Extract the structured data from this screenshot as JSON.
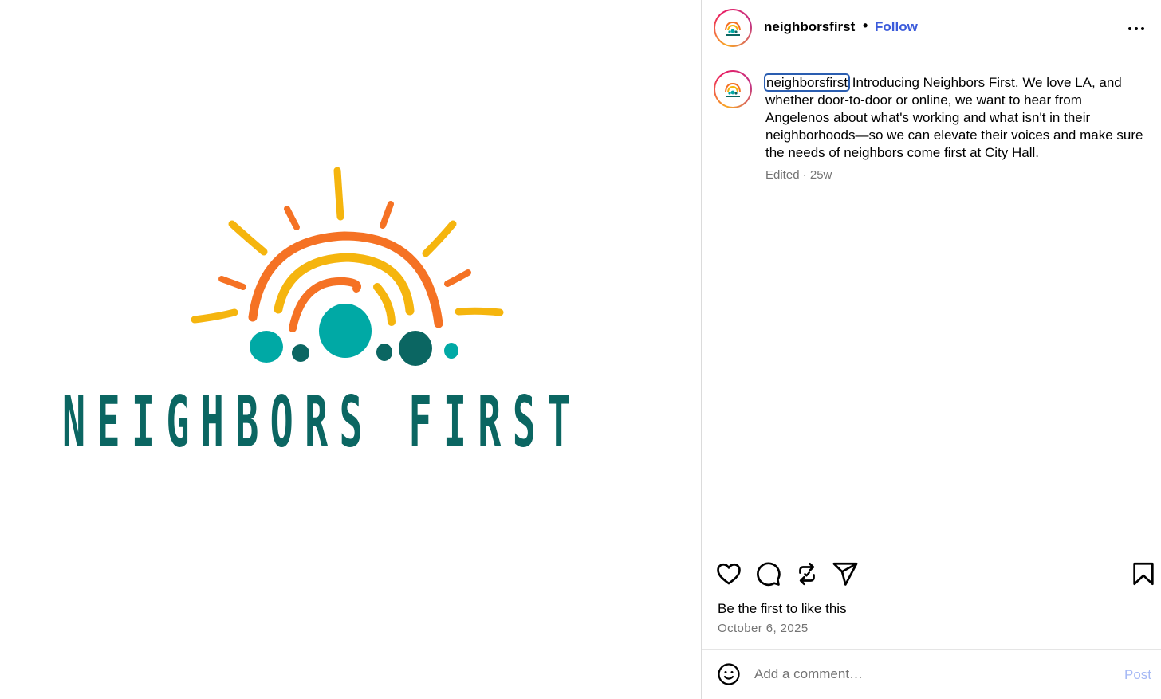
{
  "post": {
    "brand_wordmark": "NEIGHBORS FIRST",
    "colors": {
      "teal_dark": "#0b6662",
      "teal": "#00a9a5",
      "orange": "#f57224",
      "yellow": "#f5b50e",
      "follow_blue": "#3b5bdb"
    }
  },
  "header": {
    "username": "neighborsfirst",
    "separator": "•",
    "follow_label": "Follow",
    "more_icon": "more-horizontal-icon"
  },
  "caption": {
    "username": "neighborsfirst",
    "text": "Introducing Neighbors First. We love LA, and whether door-to-door or online, we want to hear from Angelenos about what's working and what isn't in their neighborhoods—so we can elevate their voices and make sure the needs of neighbors come first at City Hall.",
    "meta": "Edited · 25w"
  },
  "actions": {
    "icons": [
      "heart-icon",
      "comment-icon",
      "repost-icon",
      "share-icon",
      "bookmark-icon"
    ]
  },
  "likes_text": "Be the first to like this",
  "date_text": "October 6, 2025",
  "comment": {
    "placeholder": "Add a comment…",
    "post_label": "Post",
    "emoji_icon": "emoji-icon"
  }
}
